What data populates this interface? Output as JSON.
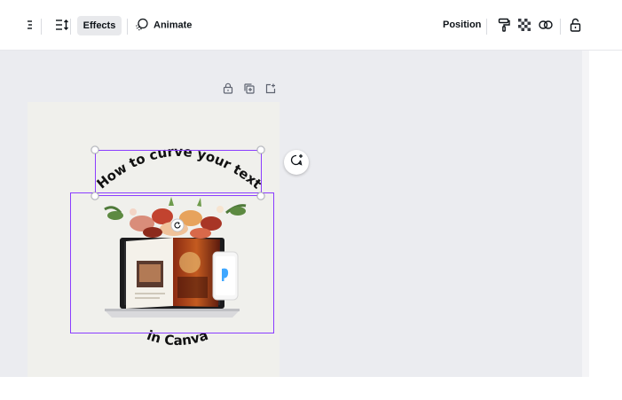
{
  "toolbar": {
    "effects_label": "Effects",
    "animate_label": "Animate",
    "position_label": "Position",
    "icons": [
      "align-icon",
      "line-spacing-icon",
      "animate-icon",
      "paint-format-icon",
      "transparency-icon",
      "link-icon",
      "lock-icon"
    ]
  },
  "page_toolbar": {
    "icons": [
      "lock-icon",
      "duplicate-icon",
      "add-page-icon"
    ]
  },
  "design": {
    "curved_title": "How to curve your text",
    "curved_subtitle": "in Canva"
  },
  "colors": {
    "selection": "#8b3dff",
    "workspace": "#ebecf0",
    "page": "#f0f0ec",
    "accent_phone_logo": "#3fa7ff"
  }
}
